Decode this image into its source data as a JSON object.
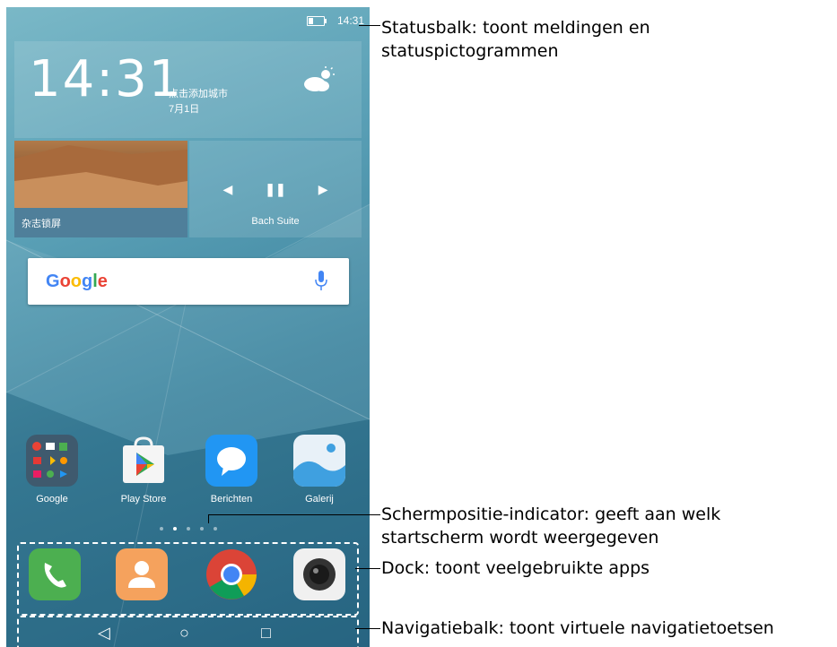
{
  "statusbar": {
    "time": "14:31"
  },
  "clock": {
    "time": "14:31",
    "city": "点击添加城市",
    "date": "7月1日"
  },
  "photo_widget": {
    "label": "杂志锁屏"
  },
  "music_widget": {
    "prev": "◀",
    "pause": "❚❚",
    "next": "▶",
    "title": "Bach Suite"
  },
  "search": {
    "logo": "Google"
  },
  "apps": [
    {
      "label": "Google",
      "icon": "google-folder-icon"
    },
    {
      "label": "Play Store",
      "icon": "play-store-icon"
    },
    {
      "label": "Berichten",
      "icon": "messages-icon"
    },
    {
      "label": "Galerij",
      "icon": "gallery-icon"
    }
  ],
  "dock": [
    "phone-icon",
    "contacts-icon",
    "chrome-icon",
    "camera-icon"
  ],
  "navbar": {
    "back": "◁",
    "home": "○",
    "recent": "□"
  },
  "callouts": {
    "statusbar": "Statusbalk: toont meldingen en statuspictogrammen",
    "indicator": "Schermpositie-indicator: geeft aan welk startscherm wordt weergegeven",
    "dock": "Dock: toont veelgebruikte apps",
    "navbar": "Navigatiebalk: toont virtuele navigatietoetsen"
  },
  "colors": {
    "wallpaper": "#3f86a0",
    "phone_icon": "#4caf50",
    "contacts_icon": "#f5a25d",
    "messages_icon": "#2196f3",
    "gallery_icon": "#3fa0e0"
  }
}
